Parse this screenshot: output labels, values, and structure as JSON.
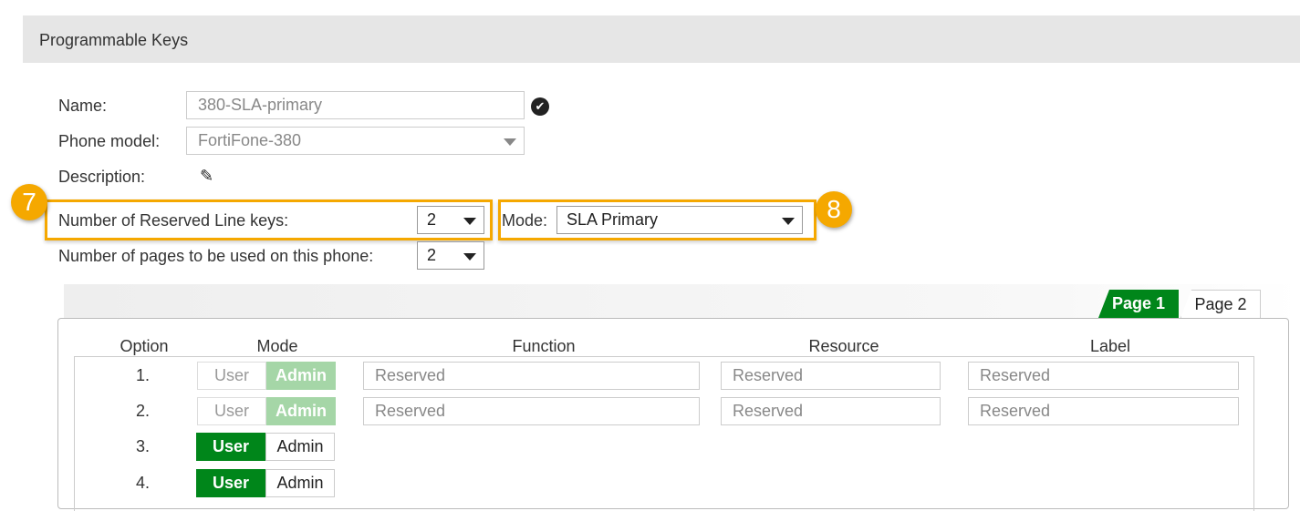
{
  "header": {
    "title": "Programmable Keys"
  },
  "form": {
    "name_label": "Name:",
    "name_value": "380-SLA-primary",
    "model_label": "Phone model:",
    "model_value": "FortiFone-380",
    "description_label": "Description:",
    "reserved_label": "Number of Reserved Line keys:",
    "reserved_value": "2",
    "mode_label": "Mode:",
    "mode_value": "SLA Primary",
    "pages_label": "Number of pages to be used on this phone:",
    "pages_value": "2"
  },
  "callouts": [
    "7",
    "8"
  ],
  "tabs": [
    "Page 1",
    "Page 2"
  ],
  "table": {
    "headers": [
      "Option",
      "Mode",
      "Function",
      "Resource",
      "Label"
    ],
    "rows": [
      {
        "num": "1.",
        "user": "User",
        "admin": "Admin",
        "function": "Reserved",
        "resource": "Reserved",
        "label": "Reserved"
      },
      {
        "num": "2.",
        "user": "User",
        "admin": "Admin",
        "function": "Reserved",
        "resource": "Reserved",
        "label": "Reserved"
      },
      {
        "num": "3.",
        "user": "User",
        "admin": "Admin"
      },
      {
        "num": "4.",
        "user": "User",
        "admin": "Admin"
      }
    ]
  },
  "colors": {
    "accent": "#f5a800",
    "green": "#00861a",
    "green_disabled": "#a5d6a7"
  }
}
